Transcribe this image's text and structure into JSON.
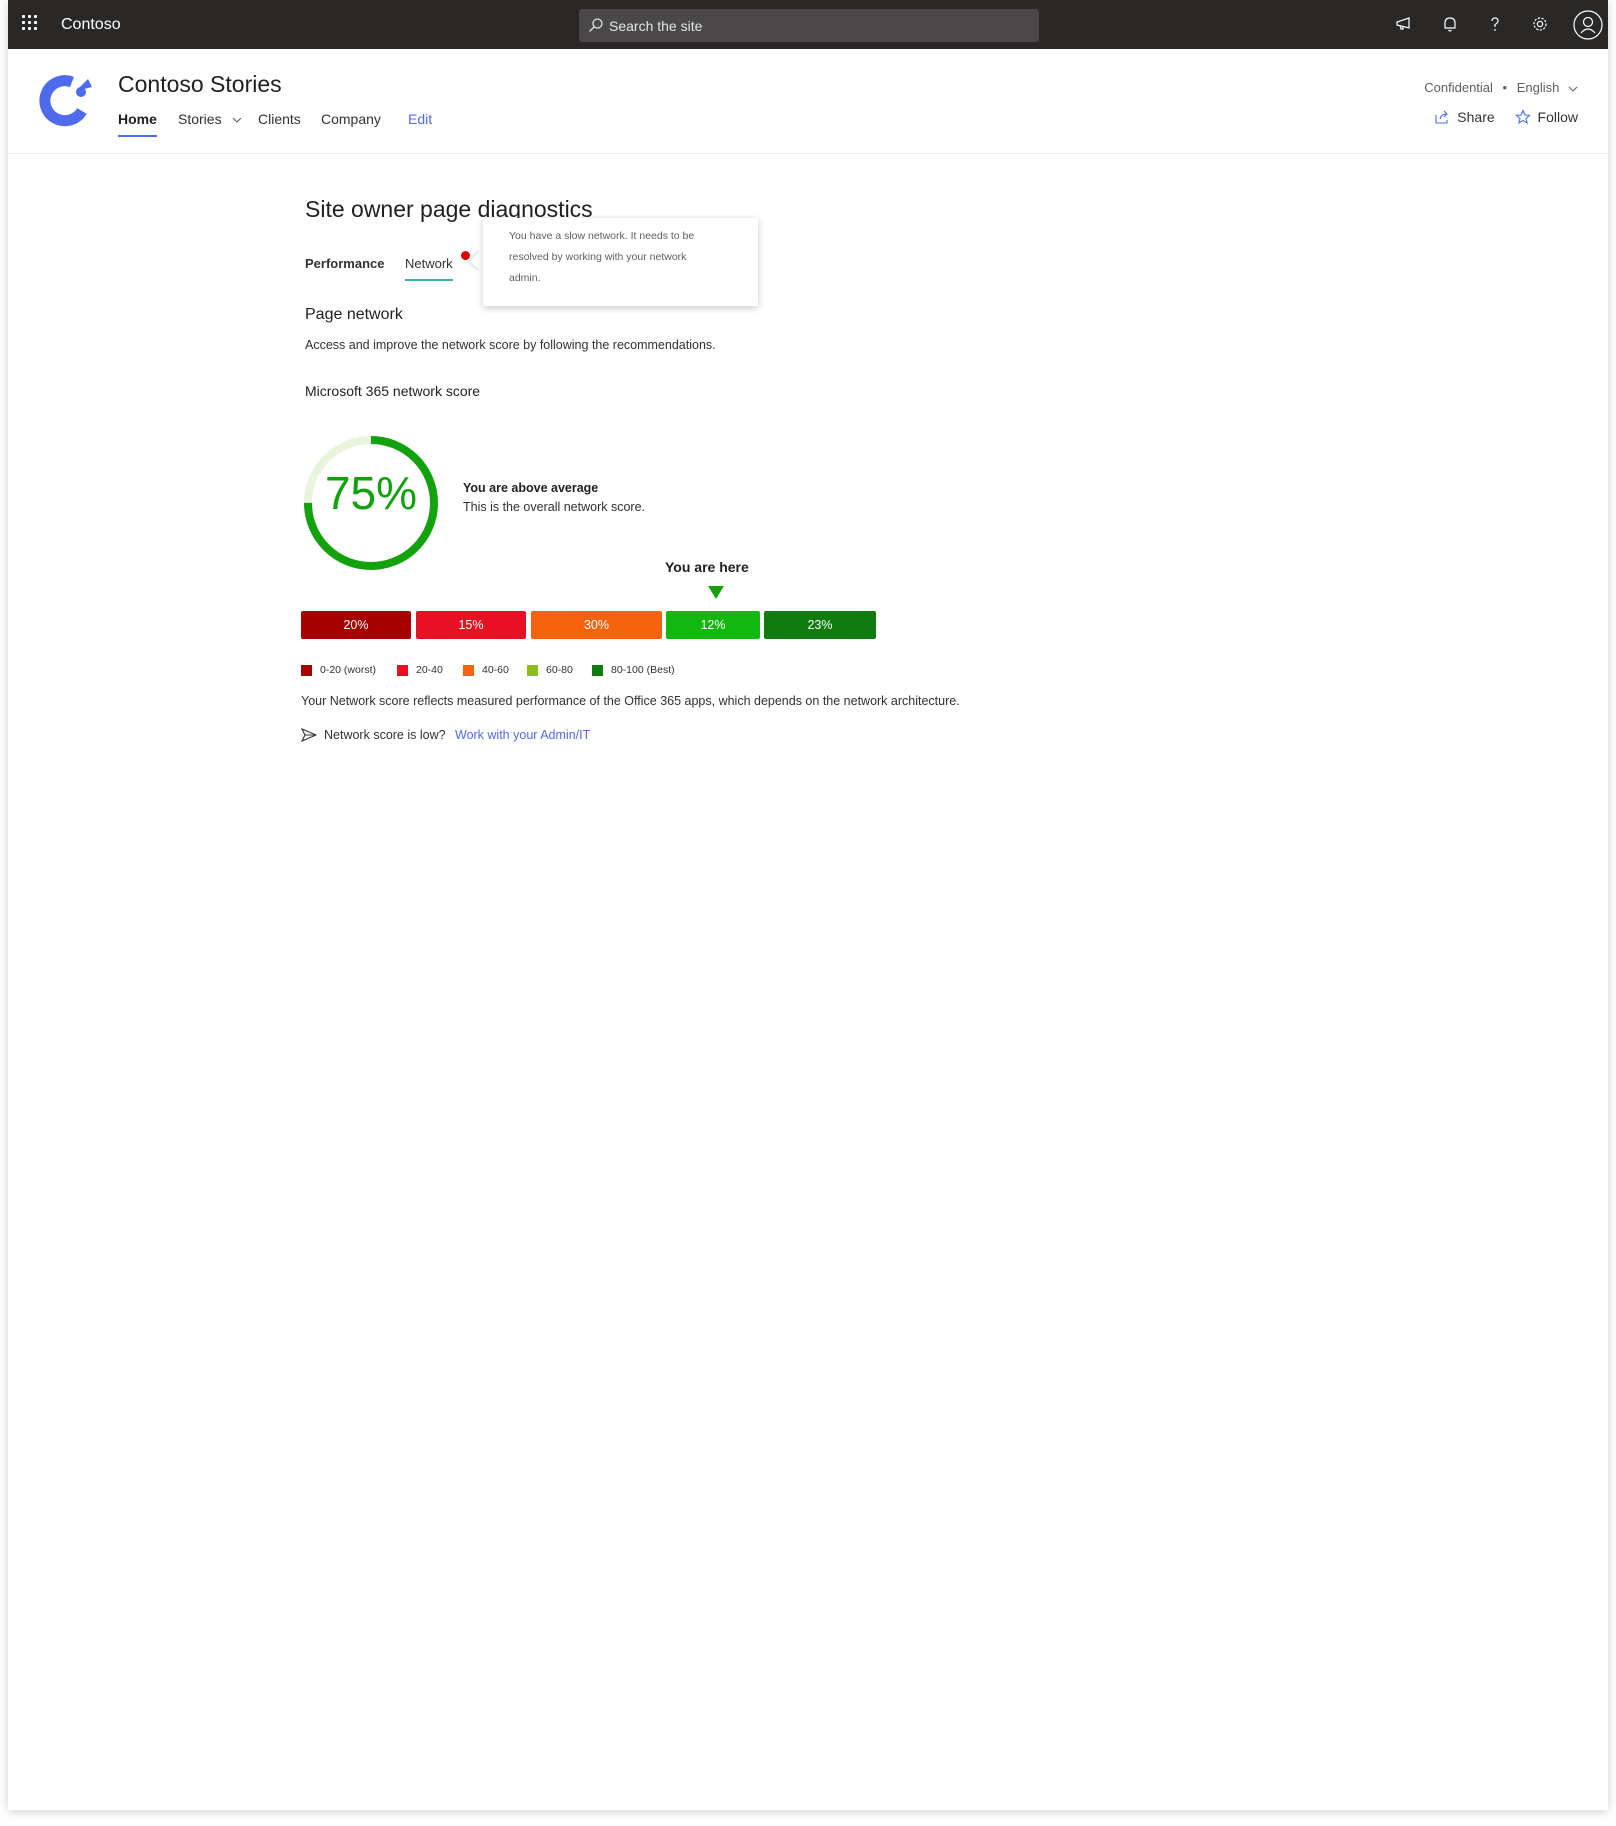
{
  "suite_bar": {
    "app_name": "Contoso",
    "search_placeholder": "Search the site",
    "icons": [
      "waffle-icon",
      "megaphone-icon",
      "bell-icon",
      "help-icon",
      "settings-icon",
      "profile-icon"
    ],
    "background": "#292827"
  },
  "site": {
    "title": "Contoso Stories",
    "nav": [
      {
        "label": "Home",
        "active": true
      },
      {
        "label": "Stories",
        "dropdown": true
      },
      {
        "label": "Clients"
      },
      {
        "label": "Company"
      },
      {
        "label": "Edit"
      }
    ],
    "sensitivity": "Confidential",
    "separator": "•",
    "language": "English",
    "share_label": "Share",
    "follow_label": "Follow",
    "accent": "#4f6bed"
  },
  "diagnostics": {
    "title": "Site owner page diagnostics",
    "tabs": [
      {
        "label": "Performance"
      },
      {
        "label": "Network",
        "selected": true,
        "alert": true
      }
    ],
    "tooltip_lines": [
      "You have a slow network. It needs to be",
      "resolved by working with your network",
      "admin."
    ],
    "section_title": "Page network",
    "section_desc": "Access and improve the network score by following the recommendations.",
    "score_title": "Microsoft 365 network score",
    "score": {
      "value": 75,
      "display": "75%",
      "color": "#13a10e",
      "status_title": "You are above average",
      "status_desc": "This is the overall network score."
    },
    "you_are_here": "You are here",
    "distribution": [
      {
        "range": "0-20 (worst)",
        "percent": "20%",
        "color": "#a80000"
      },
      {
        "range": "20-40",
        "percent": "15%",
        "color": "#e81123"
      },
      {
        "range": "40-60",
        "percent": "30%",
        "color": "#f7630c"
      },
      {
        "range": "60-80",
        "percent": "12%",
        "color": "#13b80e"
      },
      {
        "range": "80-100 (Best)",
        "percent": "23%",
        "color": "#107c10"
      }
    ],
    "legend_colors": [
      "#a80000",
      "#e81123",
      "#f7630c",
      "#8cbd18",
      "#107c10"
    ],
    "footer_text": "Your Network score reflects measured performance of the Office 365 apps, which depends on the network architecture.",
    "low_question": "Network score is low?",
    "low_link": "Work with your Admin/IT"
  }
}
